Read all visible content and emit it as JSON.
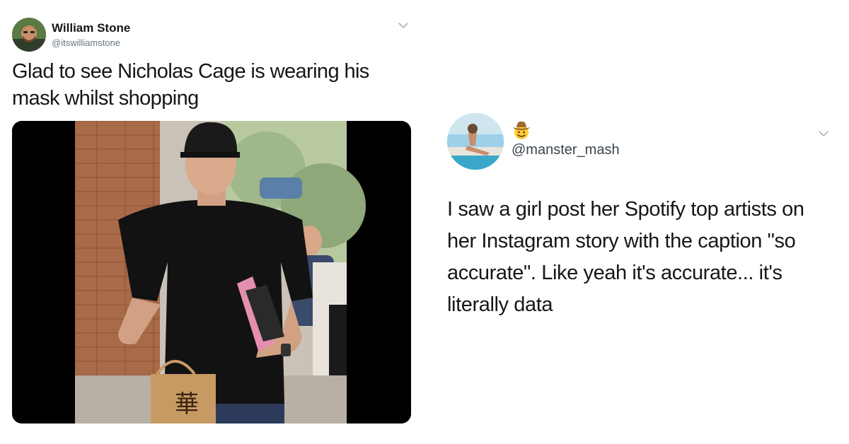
{
  "left_tweet": {
    "author_name": "William Stone",
    "author_handle": "@itswilliamstone",
    "text": "Glad to see Nicholas Cage is wearing his mask whilst shopping",
    "media": {
      "icon": "photo-man-in-cap-black-tshirt-holding-shopping-bag",
      "bag_text": "華"
    }
  },
  "right_tweet": {
    "author_handle": "@manster_mash",
    "emoji": "cowboy-hat-face-emoji",
    "text": "I saw a girl post her Spotify top artists on her Instagram story with the caption \"so accurate\". Like yeah it's accurate... it's literally data"
  },
  "colors": {
    "text_primary": "#14171a",
    "text_secondary": "#657786",
    "chevron": "#aab8c2",
    "background": "#ffffff"
  }
}
